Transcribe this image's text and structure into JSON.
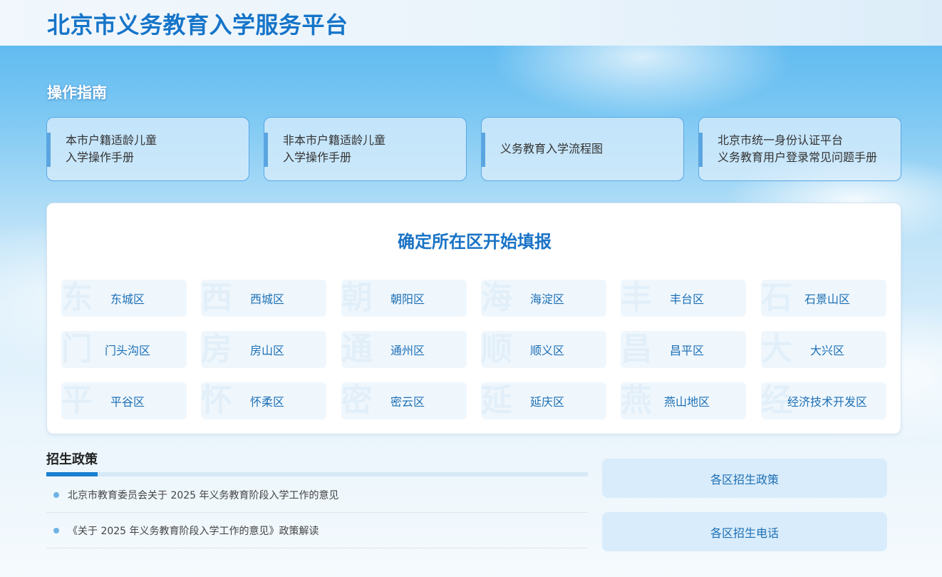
{
  "header": {
    "title": "北京市义务教育入学服务平台"
  },
  "guide": {
    "heading": "操作指南",
    "cards": [
      {
        "line1": "本市户籍适龄儿童",
        "line2": "入学操作手册"
      },
      {
        "line1": "非本市户籍适龄儿童",
        "line2": "入学操作手册"
      },
      {
        "line1": "义务教育入学流程图",
        "line2": ""
      },
      {
        "line1": "北京市统一身份认证平台",
        "line2": "义务教育用户登录常见问题手册"
      }
    ]
  },
  "districts": {
    "title": "确定所在区开始填报",
    "items": [
      {
        "label": "东城区",
        "mark": "东"
      },
      {
        "label": "西城区",
        "mark": "西"
      },
      {
        "label": "朝阳区",
        "mark": "朝"
      },
      {
        "label": "海淀区",
        "mark": "海"
      },
      {
        "label": "丰台区",
        "mark": "丰"
      },
      {
        "label": "石景山区",
        "mark": "石"
      },
      {
        "label": "门头沟区",
        "mark": "门"
      },
      {
        "label": "房山区",
        "mark": "房"
      },
      {
        "label": "通州区",
        "mark": "通"
      },
      {
        "label": "顺义区",
        "mark": "顺"
      },
      {
        "label": "昌平区",
        "mark": "昌"
      },
      {
        "label": "大兴区",
        "mark": "大"
      },
      {
        "label": "平谷区",
        "mark": "平"
      },
      {
        "label": "怀柔区",
        "mark": "怀"
      },
      {
        "label": "密云区",
        "mark": "密"
      },
      {
        "label": "延庆区",
        "mark": "延"
      },
      {
        "label": "燕山地区",
        "mark": "燕"
      },
      {
        "label": "经济技术开发区",
        "mark": "经"
      }
    ]
  },
  "policy": {
    "heading": "招生政策",
    "items": [
      "北京市教育委员会关于 2025 年义务教育阶段入学工作的意见",
      "《关于 2025 年义务教育阶段入学工作的意见》政策解读"
    ],
    "side_buttons": [
      "各区招生政策",
      "各区招生电话"
    ]
  }
}
